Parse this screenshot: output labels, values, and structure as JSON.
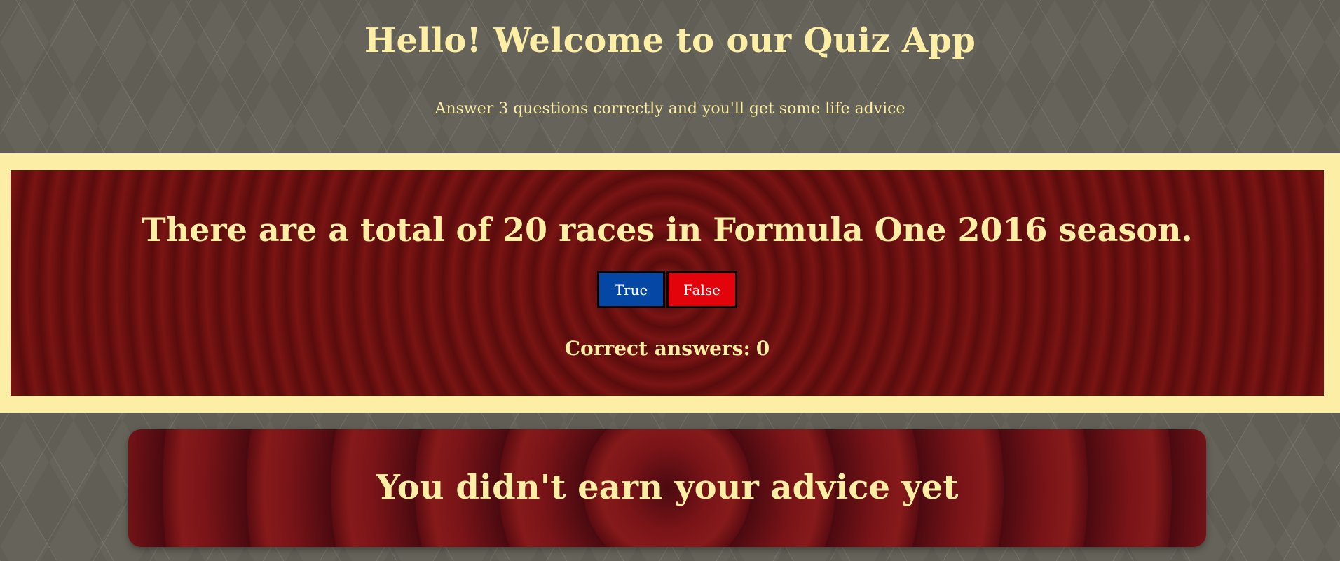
{
  "header": {
    "title": "Hello! Welcome to our Quiz App",
    "subtitle": "Answer 3 questions correctly and you'll get some life advice"
  },
  "quiz": {
    "question": "There are a total of 20 races in Formula One 2016 season.",
    "true_label": "True",
    "false_label": "False",
    "score_label": "Correct answers:",
    "score_value": "0"
  },
  "advice": {
    "message": "You didn't earn your advice yet"
  },
  "colors": {
    "text_accent": "#fdeea6",
    "true_button": "#0547a4",
    "false_button": "#e2030b",
    "panel_red": "#7a1414",
    "background": "#66645a"
  }
}
